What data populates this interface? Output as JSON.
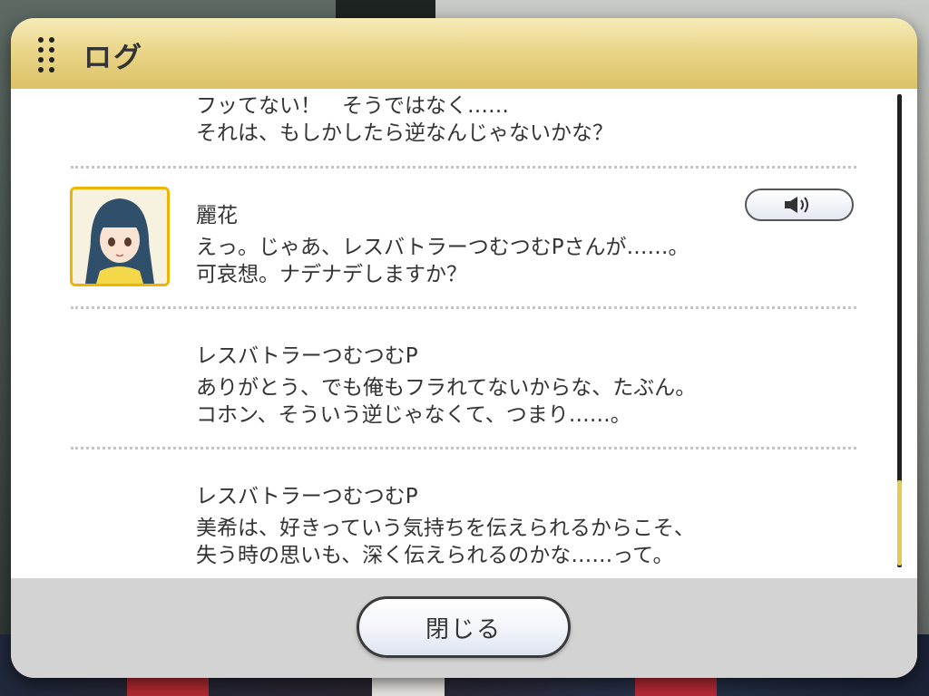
{
  "header": {
    "title": "ログ",
    "grip_icon": "drag-grip-icon"
  },
  "log": {
    "entries": [
      {
        "speaker": "",
        "lines": "フッてない！　そうではなく……\nそれは、もしかしたら逆なんじゃないかな？"
      },
      {
        "speaker": "麗花",
        "has_avatar": true,
        "has_voice": true,
        "voice_icon": "speaker-icon",
        "lines": "えっ。じゃあ、レスバトラーつむつむPさんが……。\n可哀想。ナデナデしますか？"
      },
      {
        "speaker": "レスバトラーつむつむP",
        "lines": "ありがとう、でも俺もフラれてないからな、たぶん。\nコホン、そういう逆じゃなくて、つまり……。"
      },
      {
        "speaker": "レスバトラーつむつむP",
        "lines": "美希は、好きっていう気持ちを伝えられるからこそ、\n失う時の思いも、深く伝えられるのかな……って。"
      }
    ]
  },
  "footer": {
    "close_label": "閉じる"
  },
  "colors": {
    "header_gold": "#e6cf7c",
    "avatar_border": "#f0b400",
    "scroll_thumb": "#e3cb55"
  }
}
